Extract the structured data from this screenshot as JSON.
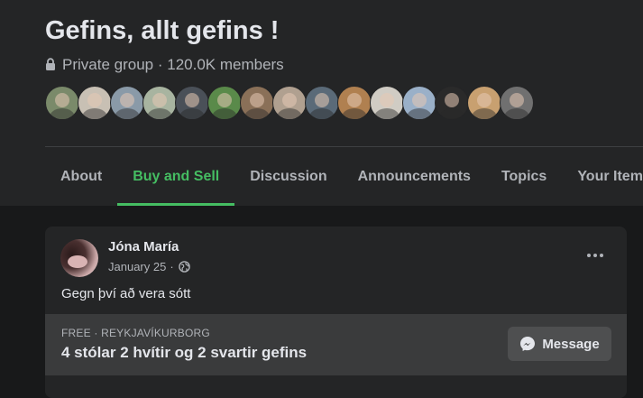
{
  "group": {
    "title": "Gefins, allt gefins !",
    "privacy": "Private group",
    "members": "120.0K members"
  },
  "member_avatars": [
    {
      "color": "#7a8a6a"
    },
    {
      "color": "#c8c0b4"
    },
    {
      "color": "#8a9aa8"
    },
    {
      "color": "#a8b4a0"
    },
    {
      "color": "#4a5058"
    },
    {
      "color": "#5a8a4a"
    },
    {
      "color": "#8a7058"
    },
    {
      "color": "#b0a090"
    },
    {
      "color": "#5a6a78"
    },
    {
      "color": "#b08050"
    },
    {
      "color": "#d0ccc4"
    },
    {
      "color": "#9ab0c8"
    },
    {
      "color": "#2a2a2a"
    },
    {
      "color": "#c8a070"
    },
    {
      "color": "#707070"
    }
  ],
  "tabs": [
    {
      "label": "About",
      "active": false
    },
    {
      "label": "Buy and Sell",
      "active": true
    },
    {
      "label": "Discussion",
      "active": false
    },
    {
      "label": "Announcements",
      "active": false
    },
    {
      "label": "Topics",
      "active": false
    },
    {
      "label": "Your Items",
      "active": false
    }
  ],
  "post": {
    "author": "Jóna María",
    "date": "January 25",
    "date_separator": "·",
    "text": "Gegn því að vera sótt",
    "listing": {
      "price": "FREE",
      "separator": "·",
      "location": "REYKJAVÍKURBORG",
      "title": "4 stólar 2 hvítir og 2 svartir gefins",
      "message_label": "Message"
    }
  },
  "colors": {
    "accent": "#45bd62",
    "background": "#18191a",
    "surface": "#242526"
  }
}
